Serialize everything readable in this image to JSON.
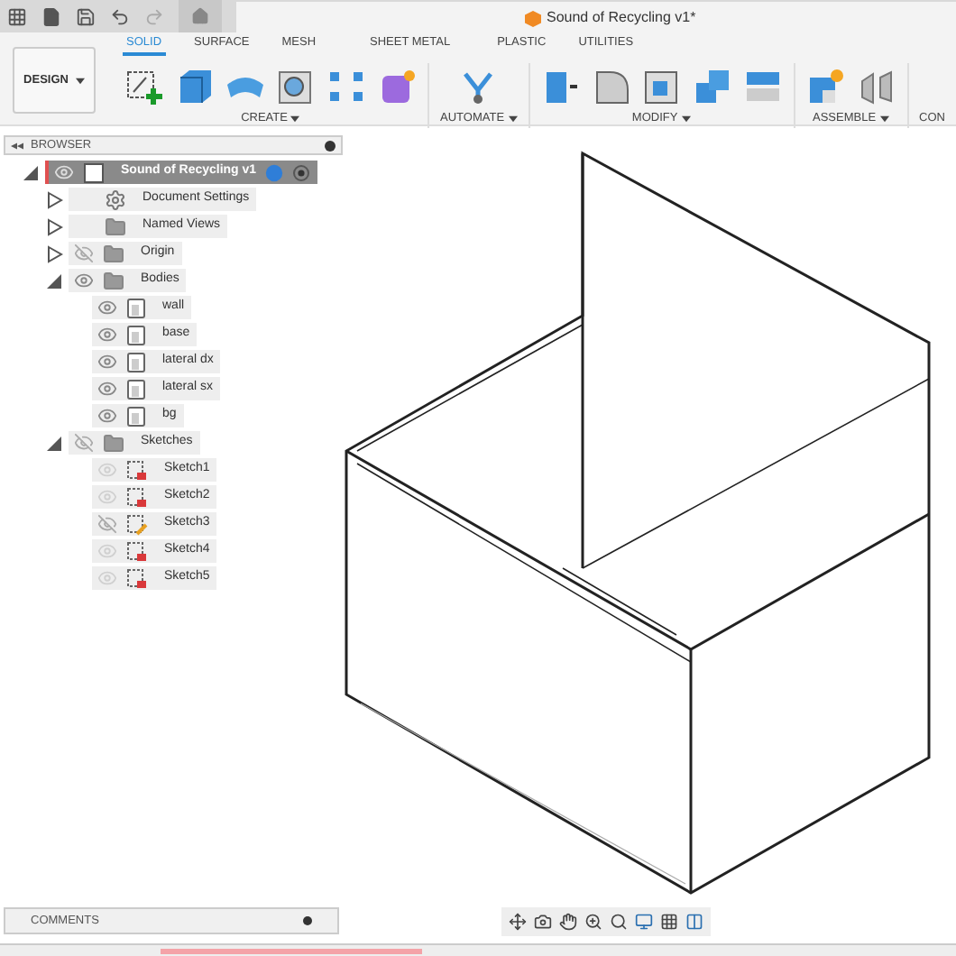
{
  "document_tab": {
    "title": "Sound of Recycling v1*"
  },
  "toolbar": {
    "workspace": "DESIGN",
    "tabs": [
      {
        "label": "SOLID",
        "selected": true
      },
      {
        "label": "SURFACE",
        "selected": false
      },
      {
        "label": "MESH",
        "selected": false
      },
      {
        "label": "SHEET METAL",
        "selected": false
      },
      {
        "label": "PLASTIC",
        "selected": false
      },
      {
        "label": "UTILITIES",
        "selected": false
      }
    ],
    "groups": [
      {
        "label": "CREATE",
        "has_menu": true,
        "tools": [
          {
            "kind": "sketch"
          },
          {
            "kind": "box"
          },
          {
            "kind": "sweep"
          },
          {
            "kind": "hole"
          },
          {
            "kind": "pattern"
          },
          {
            "kind": "form"
          }
        ]
      },
      {
        "label": "AUTOMATE",
        "has_menu": true,
        "tools": [
          {
            "kind": "automate"
          }
        ]
      },
      {
        "label": "MODIFY",
        "has_menu": true,
        "tools": [
          {
            "kind": "pressPull"
          },
          {
            "kind": "fillet"
          },
          {
            "kind": "shell"
          },
          {
            "kind": "combine"
          },
          {
            "kind": "offset"
          }
        ]
      },
      {
        "label": "ASSEMBLE",
        "has_menu": true,
        "tools": [
          {
            "kind": "component"
          },
          {
            "kind": "joint"
          }
        ]
      },
      {
        "label": "CON",
        "has_menu": false
      }
    ]
  },
  "browser": {
    "title": "BROWSER",
    "tree": [
      {
        "label": "Sound of Recycling v1",
        "kind": "component",
        "visible": true,
        "expanded": true,
        "selected": true,
        "children": [
          {
            "label": "Document Settings",
            "kind": "settings",
            "expanded": false,
            "selected": false
          },
          {
            "label": "Named Views",
            "kind": "folder",
            "expanded": false,
            "selected": false
          },
          {
            "label": "Origin",
            "kind": "folder",
            "visible": false,
            "expanded": false,
            "selected": false
          },
          {
            "label": "Bodies",
            "kind": "folder",
            "visible": true,
            "expanded": true,
            "selected": false,
            "children": [
              {
                "label": "wall",
                "kind": "body",
                "visible": true,
                "selected": false
              },
              {
                "label": "base",
                "kind": "body",
                "visible": true,
                "selected": false
              },
              {
                "label": "lateral dx",
                "kind": "body",
                "visible": true,
                "selected": false
              },
              {
                "label": "lateral sx",
                "kind": "body",
                "visible": true,
                "selected": false
              },
              {
                "label": "bg",
                "kind": "body",
                "visible": true,
                "selected": false
              }
            ]
          },
          {
            "label": "Sketches",
            "kind": "folder",
            "visible": false,
            "expanded": true,
            "selected": false,
            "children": [
              {
                "label": "Sketch1",
                "kind": "sketch",
                "visible": true,
                "locked": true,
                "selected": false
              },
              {
                "label": "Sketch2",
                "kind": "sketch",
                "visible": true,
                "locked": true,
                "selected": false
              },
              {
                "label": "Sketch3",
                "kind": "sketch",
                "visible": false,
                "locked": false,
                "selected": false
              },
              {
                "label": "Sketch4",
                "kind": "sketch",
                "visible": true,
                "locked": true,
                "selected": false
              },
              {
                "label": "Sketch5",
                "kind": "sketch",
                "visible": true,
                "locked": true,
                "selected": false
              }
            ]
          }
        ]
      }
    ]
  },
  "comments": {
    "title": "COMMENTS"
  }
}
